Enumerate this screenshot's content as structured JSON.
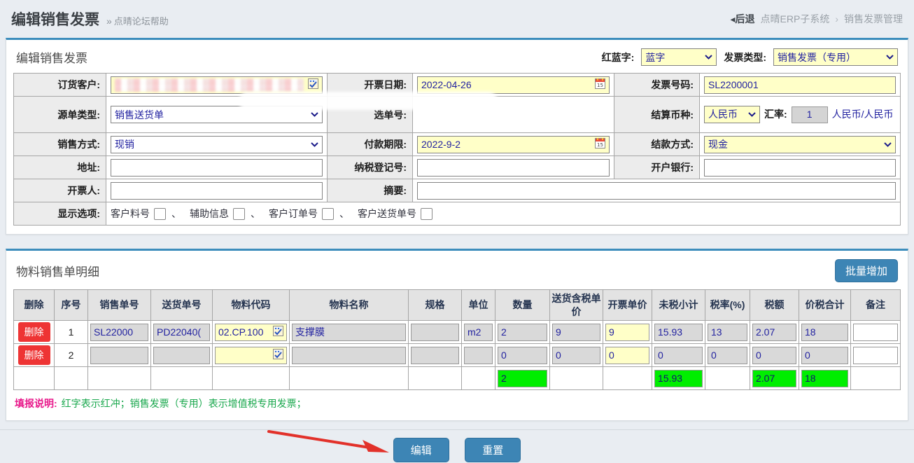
{
  "header": {
    "title": "编辑销售发票",
    "help_marker": "»",
    "help_link": "点晴论坛帮助",
    "back_icon": "◂",
    "back": "后退",
    "system": "点晴ERP子系统",
    "crumb_sep": "›",
    "section": "销售发票管理"
  },
  "invoice": {
    "heading": "编辑销售发票",
    "red_blue_label": "红蓝字:",
    "red_blue_value": "蓝字",
    "type_label": "发票类型:",
    "type_value": "销售发票（专用）",
    "customer_label": "订货客户:",
    "invoice_date_label": "开票日期:",
    "invoice_date_value": "2022-04-26",
    "invoice_no_label": "发票号码:",
    "invoice_no_value": "SL2200001",
    "source_type_label": "源单类型:",
    "source_type_value": "销售送货单",
    "pick_no_label": "选单号:",
    "currency_label": "结算币种:",
    "currency_value": "人民币",
    "rate_label": "汇率:",
    "rate_value": "1",
    "rate_unit": "人民币/人民币",
    "sale_mode_label": "销售方式:",
    "sale_mode_value": "现销",
    "due_label": "付款期限:",
    "due_value": "2022-9-2",
    "settle_label": "结款方式:",
    "settle_value": "现金",
    "address_label": "地址:",
    "tax_no_label": "纳税登记号:",
    "bank_label": "开户银行:",
    "drawer_label": "开票人:",
    "summary_label": "摘要:",
    "display_label": "显示选项:",
    "display_options": [
      "客户料号",
      "辅助信息",
      "客户订单号",
      "客户送货单号"
    ],
    "display_sep": "、"
  },
  "detail": {
    "heading": "物料销售单明细",
    "batch_add": "批量增加",
    "headers": [
      "删除",
      "序号",
      "销售单号",
      "送货单号",
      "物料代码",
      "物料名称",
      "规格",
      "单位",
      "数量",
      "送货含税单价",
      "开票单价",
      "未税小计",
      "税率(%)",
      "税额",
      "价税合计",
      "备注"
    ],
    "rows": [
      {
        "delete": "删除",
        "seq": "1",
        "sale_no": "SL22000",
        "delivery_no": "PD22040(",
        "material_code": "02.CP.100",
        "material_name": "支撑膜",
        "spec": "",
        "unit": "m2",
        "qty": "2",
        "delivery_price": "9",
        "invoice_price": "9",
        "subtotal": "15.93",
        "tax_rate": "13",
        "tax": "2.07",
        "total": "18",
        "remark": ""
      },
      {
        "delete": "删除",
        "seq": "2",
        "sale_no": "",
        "delivery_no": "",
        "material_code": "",
        "material_name": "",
        "spec": "",
        "unit": "",
        "qty": "0",
        "delivery_price": "0",
        "invoice_price": "0",
        "subtotal": "0",
        "tax_rate": "0",
        "tax": "0",
        "total": "0",
        "remark": ""
      }
    ],
    "totals": {
      "qty": "2",
      "subtotal": "15.93",
      "tax": "2.07",
      "total": "18"
    },
    "note_label": "填报说明:",
    "note_text": "红字表示红冲；销售发票（专用）表示增值税专用发票；"
  },
  "footer": {
    "edit": "编辑",
    "reset": "重置"
  },
  "colors": {
    "accent": "#3c8dbc",
    "button_blue": "#3d85b5",
    "delete_red": "#ee3434",
    "highlight_yellow": "#ffffc8",
    "readonly_gray": "#d9d9d9",
    "total_green": "#00ee00",
    "note_pink": "#e8198b",
    "note_green": "#18a74c",
    "value_navy": "#2222a0"
  }
}
